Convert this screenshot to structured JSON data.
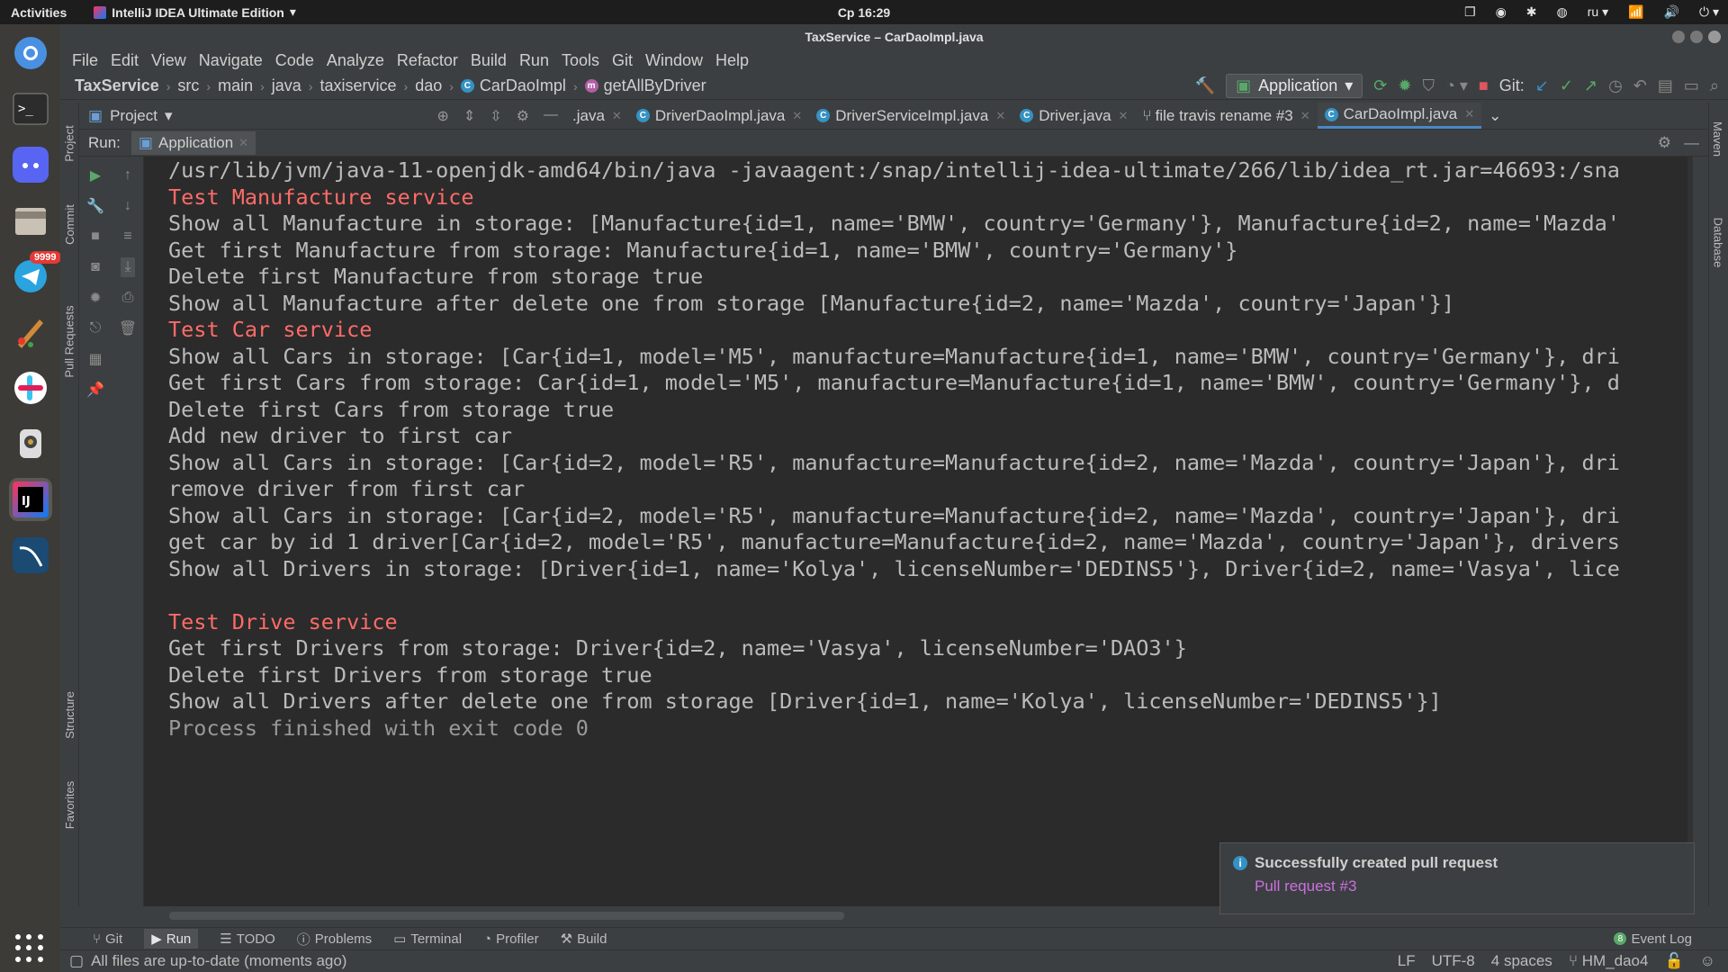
{
  "system": {
    "activities": "Activities",
    "app_name": "IntelliJ IDEA Ultimate Edition",
    "clock": "Ср 16:29",
    "keyboard_layout": "ru",
    "telegram_badge": "9999"
  },
  "window": {
    "title": "TaxService – CarDaoImpl.java"
  },
  "menu": [
    "File",
    "Edit",
    "View",
    "Navigate",
    "Code",
    "Analyze",
    "Refactor",
    "Build",
    "Run",
    "Tools",
    "Git",
    "Window",
    "Help"
  ],
  "breadcrumb": [
    "TaxService",
    "src",
    "main",
    "java",
    "taxiservice",
    "dao",
    "CarDaoImpl",
    "getAllByDriver"
  ],
  "toolbar": {
    "run_config": "Application",
    "git_label": "Git:"
  },
  "project_panel": {
    "label": "Project"
  },
  "tabs": [
    {
      "label": ".java",
      "icon": "none"
    },
    {
      "label": "DriverDaoImpl.java",
      "icon": "class"
    },
    {
      "label": "DriverServiceImpl.java",
      "icon": "class"
    },
    {
      "label": "Driver.java",
      "icon": "class"
    },
    {
      "label": "file travis rename #3",
      "icon": "pull-request"
    },
    {
      "label": "CarDaoImpl.java",
      "icon": "class"
    }
  ],
  "left_strip": [
    "Project",
    "Commit",
    "Pull Requests",
    "Structure",
    "Favorites"
  ],
  "right_strip": [
    "Maven",
    "Database"
  ],
  "run": {
    "label": "Run:",
    "tab": "Application"
  },
  "console": [
    {
      "text": "/usr/lib/jvm/java-11-openjdk-amd64/bin/java -javaagent:/snap/intellij-idea-ultimate/266/lib/idea_rt.jar=46693:/sna",
      "style": "normal"
    },
    {
      "text": "Test Manufacture service",
      "style": "err"
    },
    {
      "text": "Show all Manufacture in storage: [Manufacture{id=1, name='BMW', country='Germany'}, Manufacture{id=2, name='Mazda'",
      "style": "normal"
    },
    {
      "text": "Get first Manufacture from storage: Manufacture{id=1, name='BMW', country='Germany'}",
      "style": "normal"
    },
    {
      "text": "Delete first Manufacture from storage true",
      "style": "normal"
    },
    {
      "text": "Show all Manufacture after delete one from storage [Manufacture{id=2, name='Mazda', country='Japan'}]",
      "style": "normal"
    },
    {
      "text": "Test Car service",
      "style": "err"
    },
    {
      "text": "Show all Cars in storage: [Car{id=1, model='M5', manufacture=Manufacture{id=1, name='BMW', country='Germany'}, dri",
      "style": "normal"
    },
    {
      "text": "Get first Cars from storage: Car{id=1, model='M5', manufacture=Manufacture{id=1, name='BMW', country='Germany'}, d",
      "style": "normal"
    },
    {
      "text": "Delete first Cars from storage true",
      "style": "normal"
    },
    {
      "text": "Add new driver to first car",
      "style": "normal"
    },
    {
      "text": "Show all Cars in storage: [Car{id=2, model='R5', manufacture=Manufacture{id=2, name='Mazda', country='Japan'}, dri",
      "style": "normal"
    },
    {
      "text": "remove driver from first car",
      "style": "normal"
    },
    {
      "text": "Show all Cars in storage: [Car{id=2, model='R5', manufacture=Manufacture{id=2, name='Mazda', country='Japan'}, dri",
      "style": "normal"
    },
    {
      "text": "get car by id 1 driver[Car{id=2, model='R5', manufacture=Manufacture{id=2, name='Mazda', country='Japan'}, drivers",
      "style": "normal"
    },
    {
      "text": "Show all Drivers in storage: [Driver{id=1, name='Kolya', licenseNumber='DEDINS5'}, Driver{id=2, name='Vasya', lice",
      "style": "normal"
    },
    {
      "text": "",
      "style": "normal"
    },
    {
      "text": "Test Drive service",
      "style": "err"
    },
    {
      "text": "Get first Drivers from storage: Driver{id=2, name='Vasya', licenseNumber='DAO3'}",
      "style": "normal"
    },
    {
      "text": "Delete first Drivers from storage true",
      "style": "normal"
    },
    {
      "text": "Show all Drivers after delete one from storage [Driver{id=1, name='Kolya', licenseNumber='DEDINS5'}]",
      "style": "normal"
    },
    {
      "text": "Process finished with exit code 0",
      "style": "gray"
    }
  ],
  "notification": {
    "title": "Successfully created pull request",
    "link": "Pull request #3"
  },
  "bottom_tabs": [
    "Git",
    "Run",
    "TODO",
    "Problems",
    "Terminal",
    "Profiler",
    "Build"
  ],
  "event_log": {
    "label": "Event Log",
    "count": "8"
  },
  "status": {
    "message": "All files are up-to-date (moments ago)",
    "line_sep": "LF",
    "encoding": "UTF-8",
    "indent": "4 spaces",
    "branch": "HM_dao4"
  }
}
